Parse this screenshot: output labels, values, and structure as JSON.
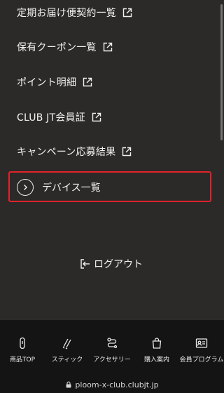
{
  "menu": {
    "items": [
      {
        "label": "定期お届け便契約一覧",
        "icon": "external-link-icon"
      },
      {
        "label": "保有クーポン一覧",
        "icon": "external-link-icon"
      },
      {
        "label": "ポイント明細",
        "icon": "external-link-icon"
      },
      {
        "label": "CLUB JT会員証",
        "icon": "external-link-icon"
      },
      {
        "label": "キャンペーン応募結果",
        "icon": "external-link-icon"
      }
    ],
    "device_list": {
      "label": "デバイス一覧",
      "icon": "circle-chevron-right-icon",
      "highlight_color": "#e0232b"
    },
    "logout": {
      "label": "ログアウト",
      "icon": "logout-icon"
    }
  },
  "tabbar": {
    "tabs": [
      {
        "label": "商品TOP",
        "icon": "device-icon"
      },
      {
        "label": "スティック",
        "icon": "sticks-icon"
      },
      {
        "label": "アクセサリー",
        "icon": "accessory-icon"
      },
      {
        "label": "購入案内",
        "icon": "shopping-bag-icon"
      },
      {
        "label": "会員プログラム",
        "icon": "member-card-icon"
      }
    ]
  },
  "browser": {
    "url": "ploom-x-club.clubjt.jp"
  }
}
